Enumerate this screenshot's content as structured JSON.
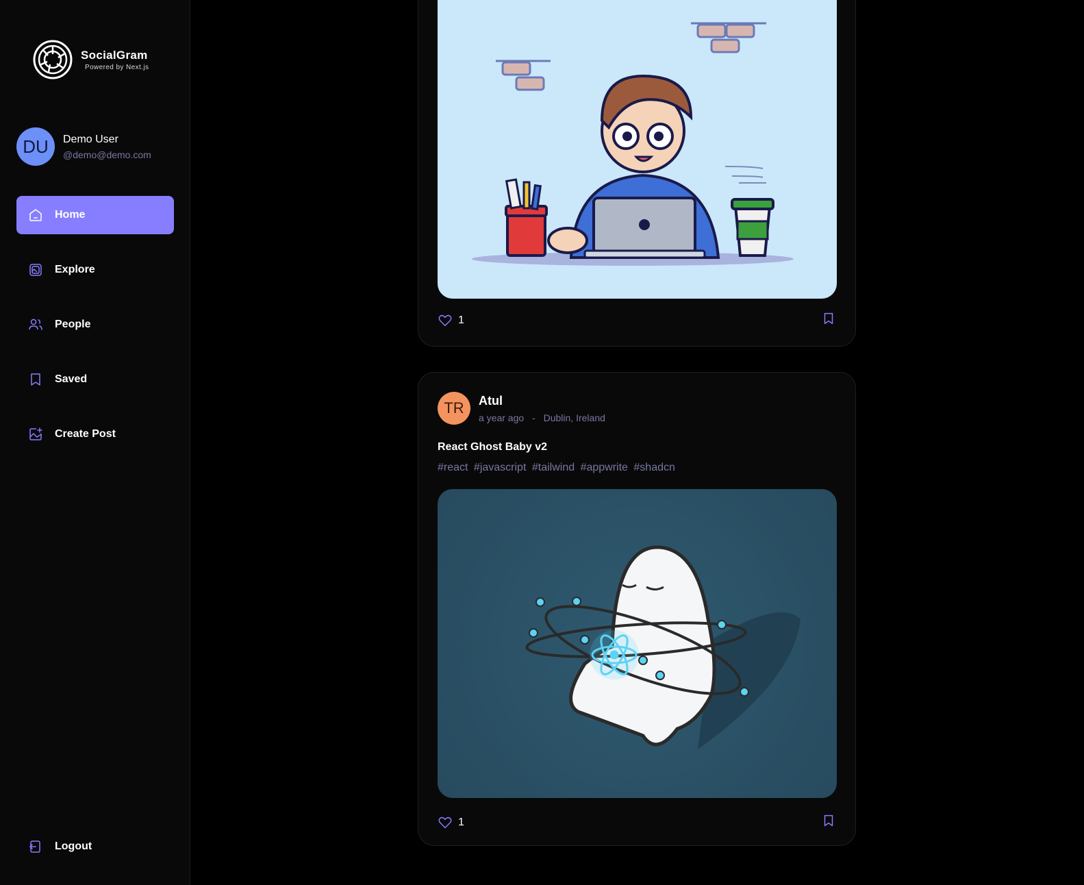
{
  "app": {
    "name": "SocialGram",
    "tagline": "Powered by Next.js"
  },
  "user": {
    "initials": "DU",
    "name": "Demo User",
    "handle": "@demo@demo.com"
  },
  "nav": {
    "items": [
      {
        "label": "Home",
        "icon": "home-icon",
        "active": true
      },
      {
        "label": "Explore",
        "icon": "explore-icon",
        "active": false
      },
      {
        "label": "People",
        "icon": "people-icon",
        "active": false
      },
      {
        "label": "Saved",
        "icon": "bookmark-icon",
        "active": false
      },
      {
        "label": "Create Post",
        "icon": "create-post-icon",
        "active": false
      }
    ],
    "logout_label": "Logout"
  },
  "posts": [
    {
      "likes": "1",
      "image_icon": "developer-illustration"
    },
    {
      "author_initials": "TR",
      "author": "Atul",
      "time": "a year ago",
      "separator": "-",
      "location": "Dublin, Ireland",
      "caption": "React Ghost Baby v2",
      "tags": [
        "#react",
        "#javascript",
        "#tailwind",
        "#appwrite",
        "#shadcn"
      ],
      "likes": "1",
      "image_icon": "react-ghost-illustration"
    }
  ],
  "colors": {
    "accent": "#877eff",
    "muted": "#7878a0",
    "background": "#000000",
    "card": "#09090a"
  }
}
